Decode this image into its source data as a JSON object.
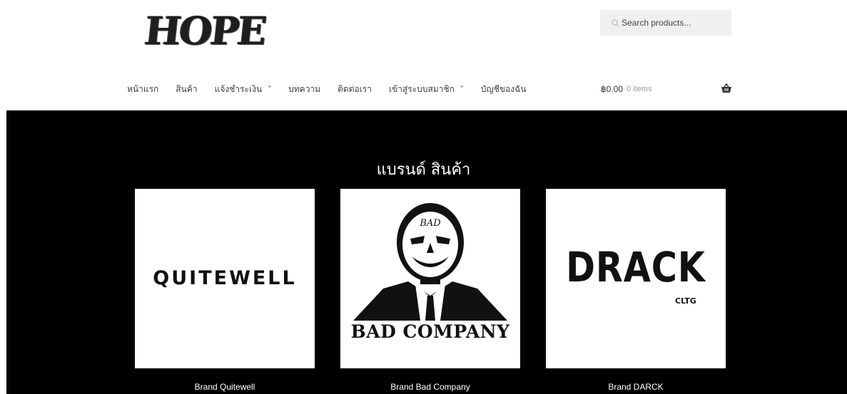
{
  "site": {
    "logo_text": "HOPE"
  },
  "search": {
    "placeholder": "Search products..."
  },
  "nav": {
    "items": [
      {
        "label": "หน้าแรก",
        "has_dropdown": false
      },
      {
        "label": "สินค้า",
        "has_dropdown": false
      },
      {
        "label": "แจ้งชำระเงิน",
        "has_dropdown": true
      },
      {
        "label": "บทความ",
        "has_dropdown": false
      },
      {
        "label": "ติดต่อเรา",
        "has_dropdown": false
      },
      {
        "label": "เข้าสู่ระบบสมาชิก",
        "has_dropdown": true
      },
      {
        "label": "บัญชีของฉัน",
        "has_dropdown": false
      }
    ]
  },
  "cart": {
    "amount": "฿0.00",
    "count": "0 items",
    "icon": "basket-icon"
  },
  "section": {
    "title": "แบรนด์ สินค้า"
  },
  "brands": [
    {
      "label": "Brand Quitewell",
      "logo_text": "QUITEWELL"
    },
    {
      "label": "Brand Bad Company",
      "logo_text": "BAD COMPANY",
      "mask_text": "BAD"
    },
    {
      "label": "Brand DARCK",
      "logo_text": "DRACK",
      "logo_subtext": "CLTG"
    }
  ],
  "colors": {
    "hero_bg": "#000000",
    "search_bg": "#f0f0f0",
    "text": "#404040"
  }
}
